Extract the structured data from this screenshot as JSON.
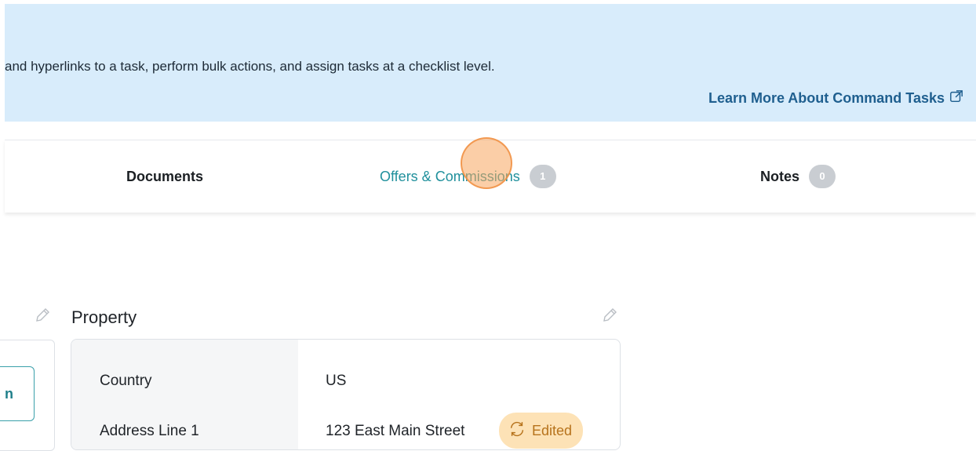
{
  "banner": {
    "text": "and hyperlinks to a task, perform bulk actions, and assign tasks at a checklist level.",
    "link_label": "Learn More About Command Tasks",
    "link_icon": "external-link-icon"
  },
  "tabs": [
    {
      "label": "Documents",
      "count": null
    },
    {
      "label": "Offers & Commissions",
      "count": "1",
      "active": true
    },
    {
      "label": "Notes",
      "count": "0"
    }
  ],
  "left_panel": {
    "button_label": "n"
  },
  "property": {
    "title": "Property",
    "rows": [
      {
        "label": "Country",
        "value": "US"
      },
      {
        "label": "Address Line 1",
        "value": "123 East Main Street",
        "badge": "Edited"
      }
    ]
  },
  "colors": {
    "banner_bg": "#d8ecfb",
    "link": "#1f5f8f",
    "active_tab": "#20909c",
    "badge_bg": "#fde2b6",
    "badge_text": "#b7731c"
  }
}
